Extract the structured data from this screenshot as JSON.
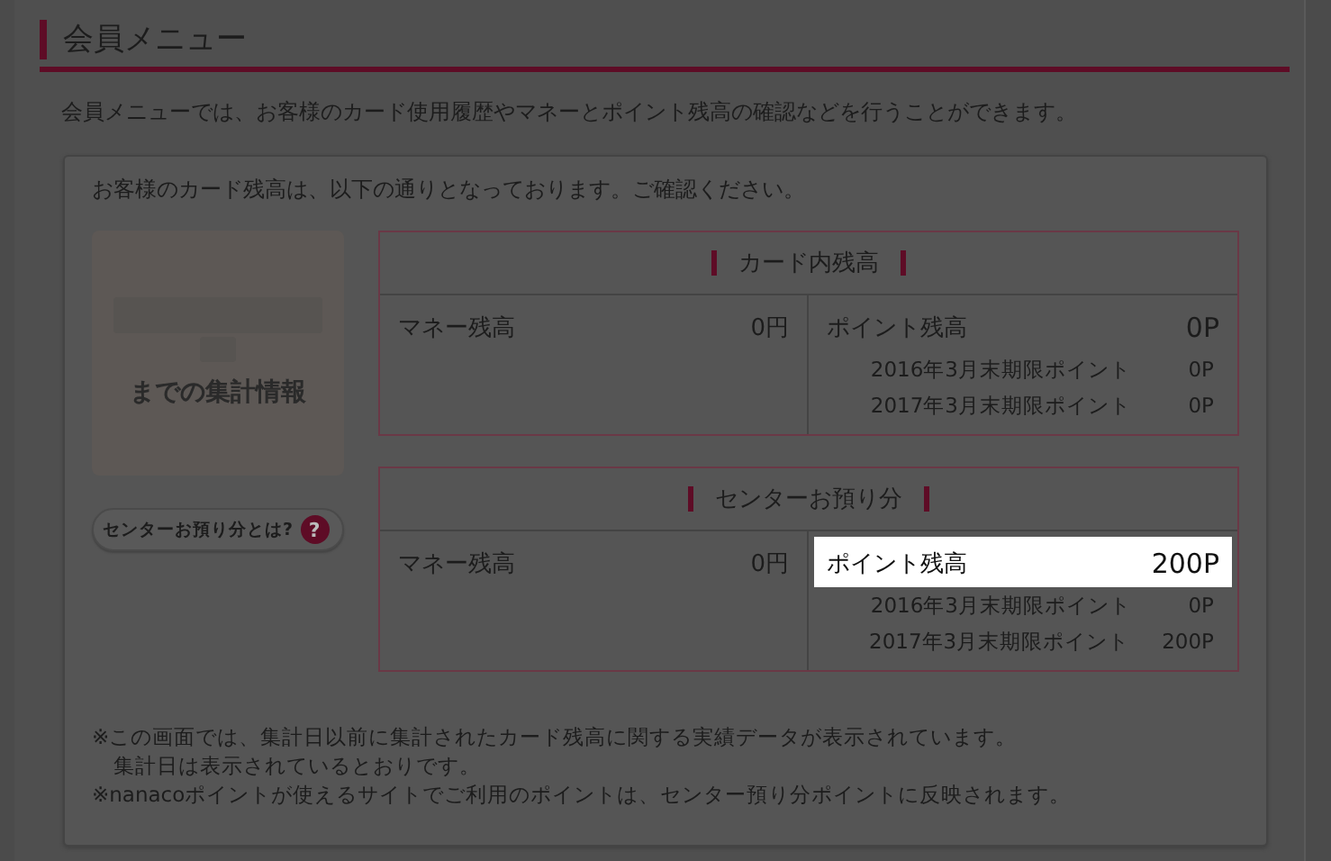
{
  "heading": "会員メニュー",
  "intro": "会員メニューでは、お客様のカード使用履歴やマネーとポイント残高の確認などを行うことができます。",
  "notice": "お客様のカード残高は、以下の通りとなっております。ご確認ください。",
  "summary_caption": "までの集計情報",
  "help_button": {
    "label": "センターお預り分とは?",
    "icon": "?"
  },
  "sections": [
    {
      "title": "カード内残高",
      "money_label": "マネー残高",
      "money_value": "0円",
      "points_label": "ポイント残高",
      "points_value": "0P",
      "highlighted": false,
      "expiries": [
        {
          "label": "2016年3月末期限ポイント",
          "value": "0P"
        },
        {
          "label": "2017年3月末期限ポイント",
          "value": "0P"
        }
      ]
    },
    {
      "title": "センターお預り分",
      "money_label": "マネー残高",
      "money_value": "0円",
      "points_label": "ポイント残高",
      "points_value": "200P",
      "highlighted": true,
      "expiries": [
        {
          "label": "2016年3月末期限ポイント",
          "value": "0P"
        },
        {
          "label": "2017年3月末期限ポイント",
          "value": "200P"
        }
      ]
    }
  ],
  "footnotes": [
    "※この画面では、集計日以前に集計されたカード残高に関する実績データが表示されています。",
    "集計日は表示されているとおりです。",
    "※nanacoポイントが使えるサイトでご利用のポイントは、センター預り分ポイントに反映されます。"
  ]
}
